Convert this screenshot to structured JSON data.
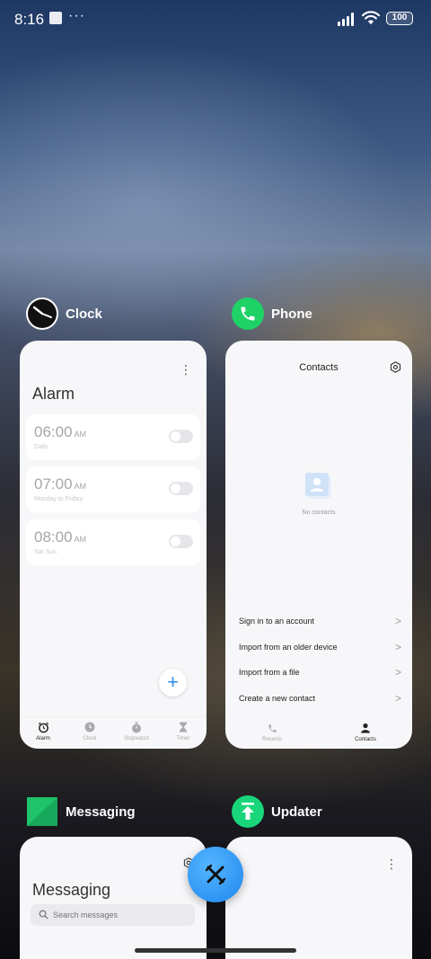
{
  "status_bar": {
    "time": "8:16",
    "more": "···",
    "battery": "100"
  },
  "recents": {
    "clock": {
      "app_name": "Clock",
      "icon": "clock-icon",
      "title": "Alarm",
      "alarms": [
        {
          "time": "06:00",
          "ampm": "AM",
          "repeat": "Daily",
          "enabled": false
        },
        {
          "time": "07:00",
          "ampm": "AM",
          "repeat": "Monday to Friday",
          "enabled": false
        },
        {
          "time": "08:00",
          "ampm": "AM",
          "repeat": "Sat Sun",
          "enabled": false
        }
      ],
      "fab": "+",
      "tabs": [
        {
          "label": "Alarm",
          "icon": "alarm-icon",
          "active": true
        },
        {
          "label": "Clock",
          "icon": "clock-tab-icon",
          "active": false
        },
        {
          "label": "Stopwatch",
          "icon": "stopwatch-icon",
          "active": false
        },
        {
          "label": "Timer",
          "icon": "hourglass-icon",
          "active": false
        }
      ]
    },
    "phone": {
      "app_name": "Phone",
      "icon": "phone-icon",
      "title": "Contacts",
      "empty_text": "No contacts",
      "options": [
        "Sign in to an account",
        "Import from an older device",
        "Import from a file",
        "Create a new contact"
      ],
      "chevron": ">",
      "tabs": [
        {
          "label": "Recents",
          "icon": "phone-tab-icon",
          "active": false
        },
        {
          "label": "Contacts",
          "icon": "person-icon",
          "active": true
        }
      ]
    },
    "messaging": {
      "app_name": "Messaging",
      "icon": "messaging-icon",
      "title": "Messaging",
      "search_placeholder": "Search messages"
    },
    "updater": {
      "app_name": "Updater",
      "icon": "updater-icon",
      "menu": "⋮"
    }
  },
  "colors": {
    "phone_green": "#1ed266",
    "messaging_green": "#1fc46a",
    "updater_green": "#19d67a",
    "accent_blue": "#2f8be8"
  }
}
